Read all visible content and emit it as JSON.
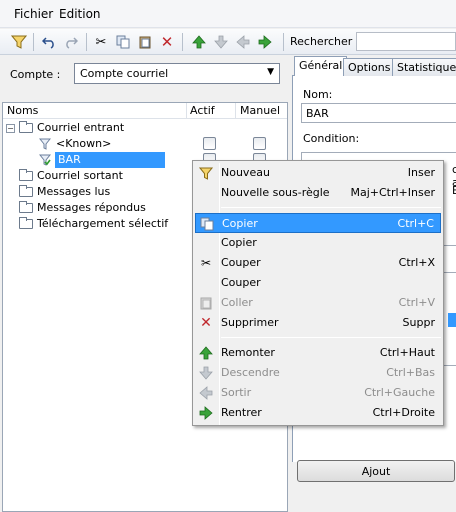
{
  "menubar": {
    "file": "Fichier",
    "edit": "Edition"
  },
  "toolbar": {
    "search_label": "Rechercher",
    "search_value": ""
  },
  "account": {
    "label": "Compte :",
    "selected": "Compte courriel"
  },
  "tree": {
    "headers": {
      "names": "Noms",
      "active": "Actif",
      "manual": "Manuel"
    },
    "rows": [
      {
        "label": "Courriel entrant"
      },
      {
        "label": "<Known>"
      },
      {
        "label": "BAR"
      },
      {
        "label": "Courriel sortant"
      },
      {
        "label": "Messages lus"
      },
      {
        "label": "Messages répondus"
      },
      {
        "label": "Téléchargement sélectif"
      }
    ]
  },
  "right": {
    "tabs": [
      "Général",
      "Options",
      "Statistiques"
    ],
    "name_label": "Nom:",
    "name_value": "BAR",
    "condition_label": "Condition:",
    "partial_1": "c-a",
    "partial_2": "BA",
    "add_button": "Ajout"
  },
  "context_menu": {
    "items": [
      {
        "label": "Nouveau",
        "shortcut": "Inser",
        "icon": "funnel-icon"
      },
      {
        "label": "Nouvelle sous-règle",
        "shortcut": "Maj+Ctrl+Inser",
        "icon": ""
      },
      {
        "label": "Copier",
        "shortcut": "Ctrl+C",
        "icon": "copy-icon"
      },
      {
        "label": "Copier",
        "shortcut": "",
        "icon": ""
      },
      {
        "label": "Couper",
        "shortcut": "Ctrl+X",
        "icon": "scissors-icon"
      },
      {
        "label": "Couper",
        "shortcut": "",
        "icon": ""
      },
      {
        "label": "Coller",
        "shortcut": "Ctrl+V",
        "icon": "paste-icon"
      },
      {
        "label": "Supprimer",
        "shortcut": "Suppr",
        "icon": "delete-icon"
      },
      {
        "label": "Remonter",
        "shortcut": "Ctrl+Haut",
        "icon": "arrow-up-icon"
      },
      {
        "label": "Descendre",
        "shortcut": "Ctrl+Bas",
        "icon": "arrow-down-icon"
      },
      {
        "label": "Sortir",
        "shortcut": "Ctrl+Gauche",
        "icon": "arrow-left-icon"
      },
      {
        "label": "Rentrer",
        "shortcut": "Ctrl+Droite",
        "icon": "arrow-right-icon"
      }
    ]
  },
  "colors": {
    "selection": "#3399ff",
    "green_arrow": "#3aa33a",
    "delete_red": "#c0282d"
  }
}
